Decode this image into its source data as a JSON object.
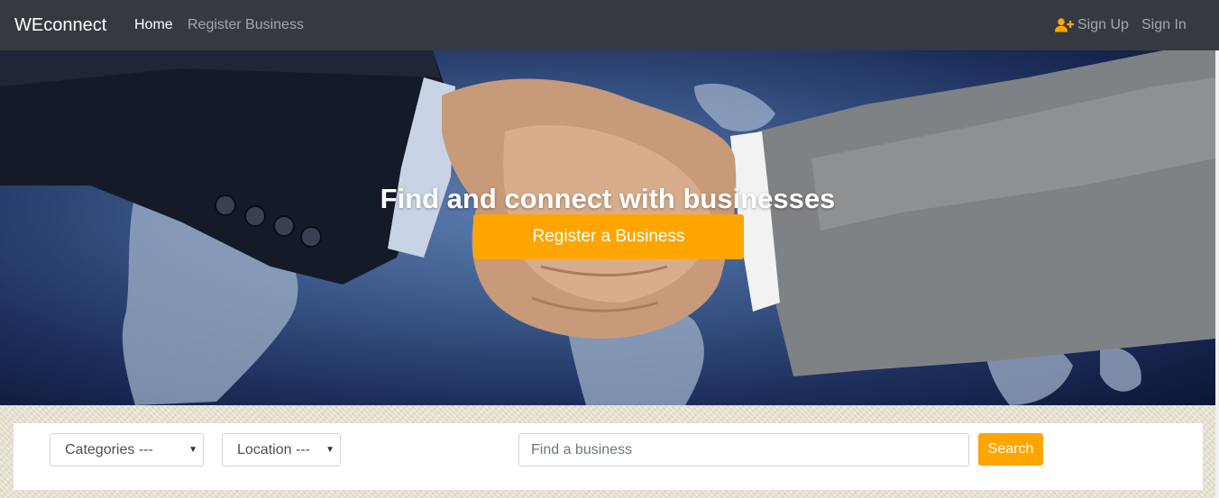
{
  "navbar": {
    "brand": "WEconnect",
    "links": {
      "home": "Home",
      "register_business": "Register Business",
      "sign_up": "Sign Up",
      "sign_in": "Sign In"
    },
    "sign_up_icon": "user-plus-icon",
    "colors": {
      "background": "#343a40",
      "active": "#ffffff",
      "inactive": "rgba(255,255,255,0.55)",
      "icon": "#ffa500"
    }
  },
  "hero": {
    "title": "Find and connect with businesses",
    "cta_label": "Register a Business",
    "image": "handshake over world map",
    "colors": {
      "cta": "#ffa500"
    }
  },
  "search": {
    "categories_selected": "Categories ---",
    "location_selected": "Location ---",
    "input_placeholder": "Find a business",
    "button_label": "Search",
    "colors": {
      "button": "#ffa500"
    }
  }
}
